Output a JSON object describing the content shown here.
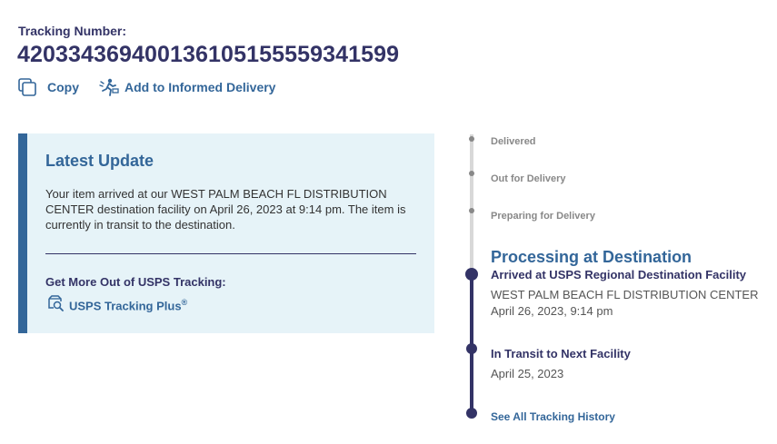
{
  "header": {
    "tracking_label": "Tracking Number:",
    "tracking_number": "420334369400136105155559341599"
  },
  "actions": {
    "copy_label": "Copy",
    "informed_label": "Add to Informed Delivery"
  },
  "latest_update": {
    "title": "Latest Update",
    "text": "Your item arrived at our WEST PALM BEACH FL DISTRIBUTION CENTER destination facility on April 26, 2023 at 9:14 pm. The item is currently in transit to the destination.",
    "more_title": "Get More Out of USPS Tracking:",
    "plus_link": "USPS Tracking Plus",
    "plus_mark": "®"
  },
  "timeline": {
    "steps": [
      "Delivered",
      "Out for Delivery",
      "Preparing for Delivery"
    ],
    "current_stage": "Processing at Destination",
    "events": [
      {
        "title": "Arrived at USPS Regional Destination Facility",
        "location": "WEST PALM BEACH FL DISTRIBUTION CENTER",
        "date": "April 26, 2023, 9:14 pm"
      },
      {
        "title": "In Transit to Next Facility",
        "date": "April 25, 2023"
      }
    ],
    "history_link": "See All Tracking History"
  },
  "colors": {
    "navy": "#333366",
    "link_blue": "#336699",
    "panel_bg": "#e6f3f8",
    "muted_grey": "#888888"
  },
  "icons": [
    "copy-icon",
    "informed-delivery-icon",
    "tracking-plus-icon"
  ]
}
